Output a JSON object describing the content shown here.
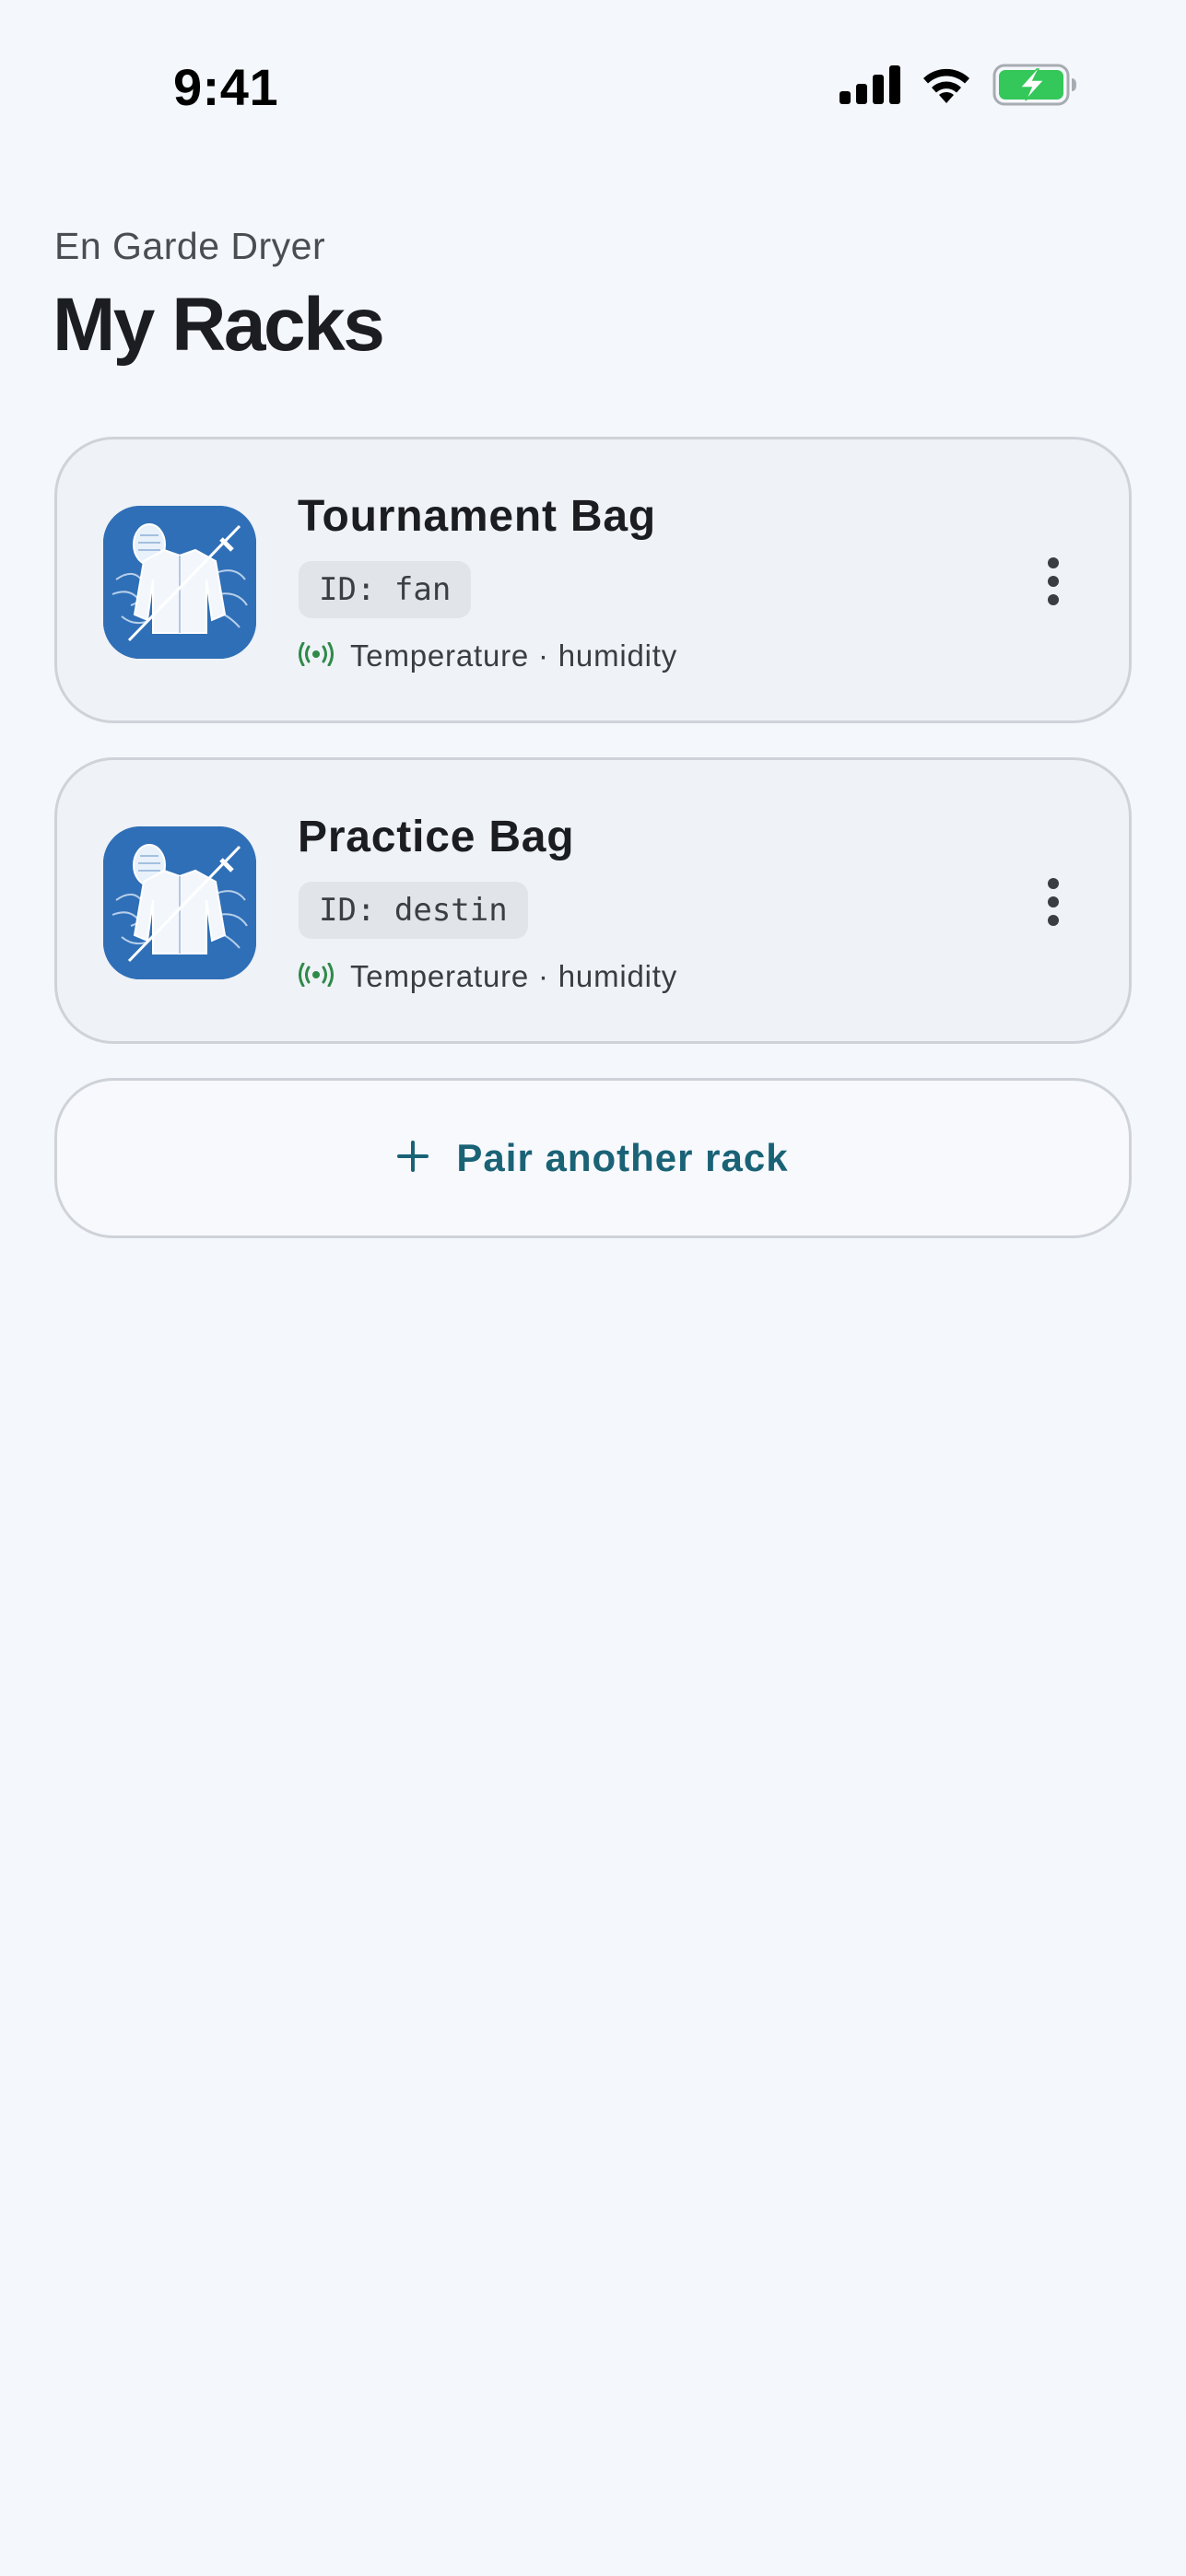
{
  "status_bar": {
    "time": "9:41"
  },
  "header": {
    "app_name": "En Garde Dryer",
    "title": "My Racks"
  },
  "racks": [
    {
      "name": "Tournament Bag",
      "id_label": "ID: fan",
      "sensors": "Temperature · humidity"
    },
    {
      "name": "Practice Bag",
      "id_label": "ID: destin",
      "sensors": "Temperature · humidity"
    }
  ],
  "pair_button": {
    "label": "Pair another rack",
    "icon": "plus-icon"
  },
  "colors": {
    "background": "#f4f7fc",
    "card_background": "#eff2f7",
    "accent": "#1a6276",
    "sensor_green": "#2f8a48",
    "icon_blue": "#2f6fb7",
    "battery_green": "#34c759"
  }
}
